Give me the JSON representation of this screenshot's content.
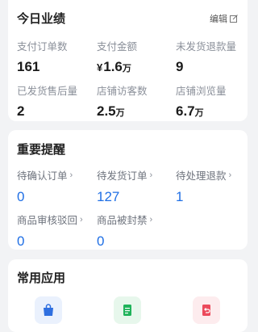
{
  "today": {
    "title": "今日业绩",
    "edit_label": "编辑",
    "stats": [
      {
        "label": "支付订单数",
        "value": "161",
        "prefix": "",
        "unit": ""
      },
      {
        "label": "支付金额",
        "value": "1.6",
        "prefix": "¥",
        "unit": "万"
      },
      {
        "label": "未发货退款量",
        "value": "9",
        "prefix": "",
        "unit": ""
      },
      {
        "label": "已发货售后量",
        "value": "2",
        "prefix": "",
        "unit": ""
      },
      {
        "label": "店铺访客数",
        "value": "2.5",
        "prefix": "",
        "unit": "万"
      },
      {
        "label": "店铺浏览量",
        "value": "6.7",
        "prefix": "",
        "unit": "万"
      }
    ]
  },
  "reminders": {
    "title": "重要提醒",
    "items": [
      {
        "label": "待确认订单",
        "value": "0"
      },
      {
        "label": "待发货订单",
        "value": "127"
      },
      {
        "label": "待处理退款",
        "value": "1"
      },
      {
        "label": "商品审核驳回",
        "value": "0"
      },
      {
        "label": "商品被封禁",
        "value": "0"
      }
    ],
    "chevron": "›"
  },
  "apps": {
    "title": "常用应用",
    "icons": [
      {
        "name": "shopping-bag-icon",
        "color": "#2f6fe0",
        "bg": "#eaf1fd"
      },
      {
        "name": "document-icon",
        "color": "#1fb35a",
        "bg": "#e7f7ec"
      },
      {
        "name": "return-icon",
        "color": "#ec4a5c",
        "bg": "#fdecee"
      }
    ]
  }
}
